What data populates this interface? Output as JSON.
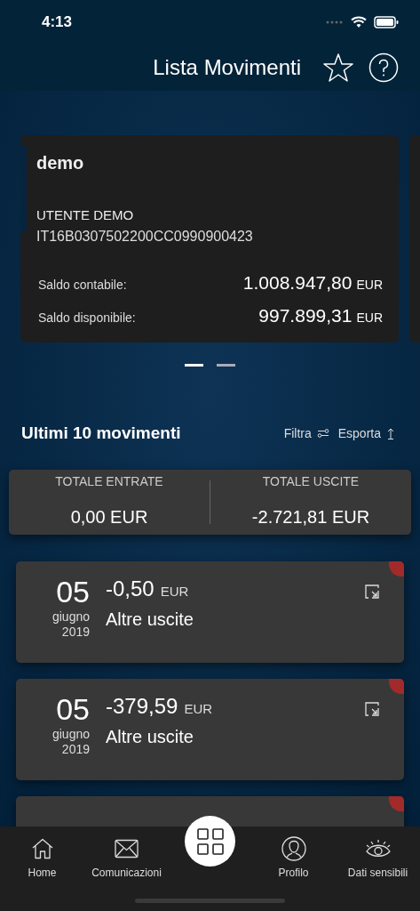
{
  "status_bar": {
    "time": "4:13"
  },
  "header": {
    "title": "Lista Movimenti"
  },
  "account_card": {
    "name": "demo",
    "holder": "UTENTE DEMO",
    "iban": "IT16B0307502200CC0990900423",
    "balances": [
      {
        "label": "Saldo contabile:",
        "amount": "1.008.947,80",
        "currency": "EUR"
      },
      {
        "label": "Saldo disponibile:",
        "amount": "997.899,31",
        "currency": "EUR"
      }
    ]
  },
  "pager": [
    {
      "selected": true
    },
    {
      "selected": false
    }
  ],
  "section": {
    "title": "Ultimi 10 movimenti",
    "actions": [
      {
        "label": "Filtra"
      },
      {
        "label": "Esporta"
      }
    ]
  },
  "totals": [
    {
      "label": "TOTALE ENTRATE",
      "value": "0,00 EUR"
    },
    {
      "label": "TOTALE USCITE",
      "value": "-2.721,81 EUR"
    }
  ],
  "movements": [
    {
      "day": "05",
      "month": "giugno",
      "year": "2019",
      "amount": "-0,50",
      "currency": "EUR",
      "category": "Altre uscite"
    },
    {
      "day": "05",
      "month": "giugno",
      "year": "2019",
      "amount": "-379,59",
      "currency": "EUR",
      "category": "Altre uscite"
    }
  ],
  "more_movements_below": true,
  "tab_bar": [
    {
      "label": "Home"
    },
    {
      "label": "Comunicazioni"
    },
    {
      "label": "Profilo"
    },
    {
      "label": "Dati sensibili"
    }
  ]
}
